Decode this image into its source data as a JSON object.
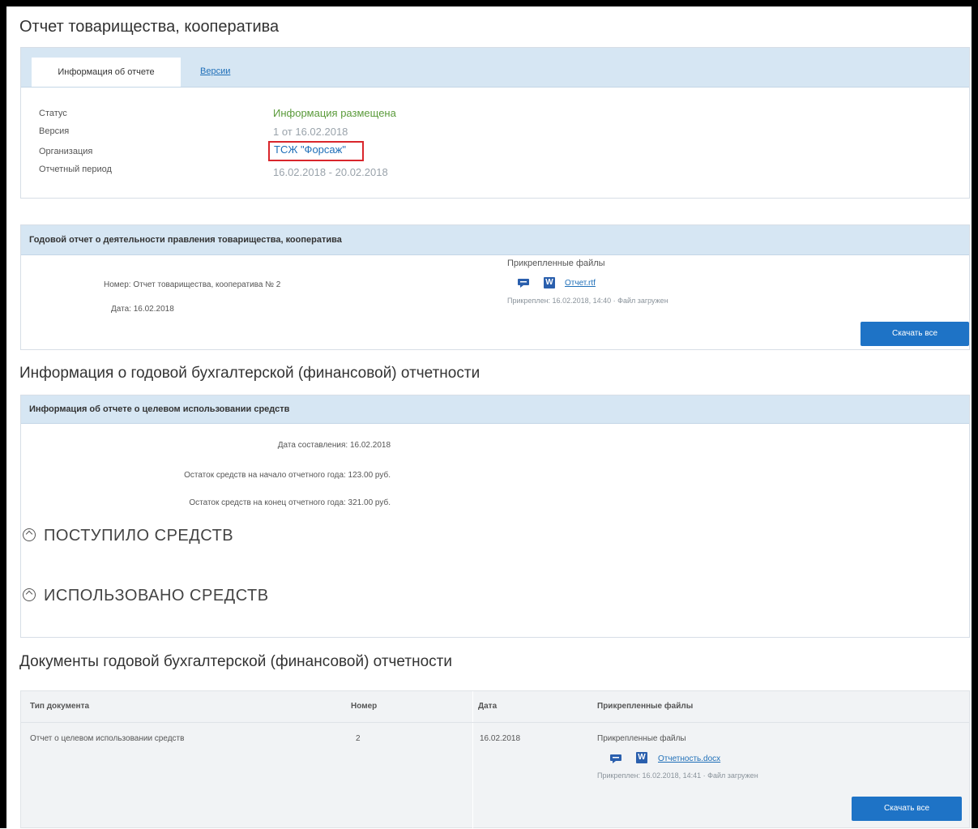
{
  "page_title": "Отчет товарищества, кооператива",
  "tabs": [
    {
      "label": "Информация об отчете"
    },
    {
      "label": "Версии"
    }
  ],
  "report_info": {
    "status_label": "Статус",
    "status_value": "Информация размещена",
    "version_label": "Версия",
    "version_value": "1 от 16.02.2018",
    "org_label": "Организация",
    "org_value": "ТСЖ \"Форсаж\"",
    "period_label": "Отчетный период",
    "period_value": "16.02.2018 - 20.02.2018"
  },
  "annual_report": {
    "header": "Годовой отчет о деятельности правления товарищества, кооператива",
    "number_line": "Номер: Отчет товарищества, кооператива № 2",
    "date_line": "Дата: 16.02.2018",
    "files_label": "Прикрепленные файлы",
    "file_name": "Отчет.rtf",
    "file_meta": "Прикреплен: 16.02.2018, 14:40 · Файл загружен",
    "download_all": "Скачать все"
  },
  "accounting_section": {
    "title": "Информация о годовой бухгалтерской (финансовой) отчетности",
    "panel_header": "Информация об отчете о целевом использовании средств",
    "date_line": "Дата составления: 16.02.2018",
    "start_balance": "Остаток средств на начало отчетного года: 123.00 руб.",
    "end_balance": "Остаток средств на конец отчетного года: 321.00 руб.",
    "received": "ПОСТУПИЛО СРЕДСТВ",
    "used": "ИСПОЛЬЗОВАНО СРЕДСТВ"
  },
  "documents_section": {
    "title": "Документы годовой бухгалтерской (финансовой) отчетности",
    "columns": [
      "Тип документа",
      "Номер",
      "Дата",
      "Прикрепленные файлы"
    ],
    "rows": [
      {
        "type": "Отчет о целевом использовании средств",
        "number": "2",
        "date": "16.02.2018",
        "files_label": "Прикрепленные файлы",
        "file_name": "Отчетность.docx",
        "file_meta": "Прикреплен: 16.02.2018, 14:41 · Файл загружен"
      }
    ],
    "download_all": "Скачать все"
  },
  "colors": {
    "panel_header_bg": "#d6e6f3",
    "status_green": "#5a9a3a",
    "link_blue": "#1f6fb8",
    "button_blue": "#1e73c6",
    "highlight_red": "#d9262c"
  },
  "icons": {
    "comment": "comment-icon",
    "word": "word-file-icon",
    "collapse": "chevron-up-circle-icon"
  }
}
